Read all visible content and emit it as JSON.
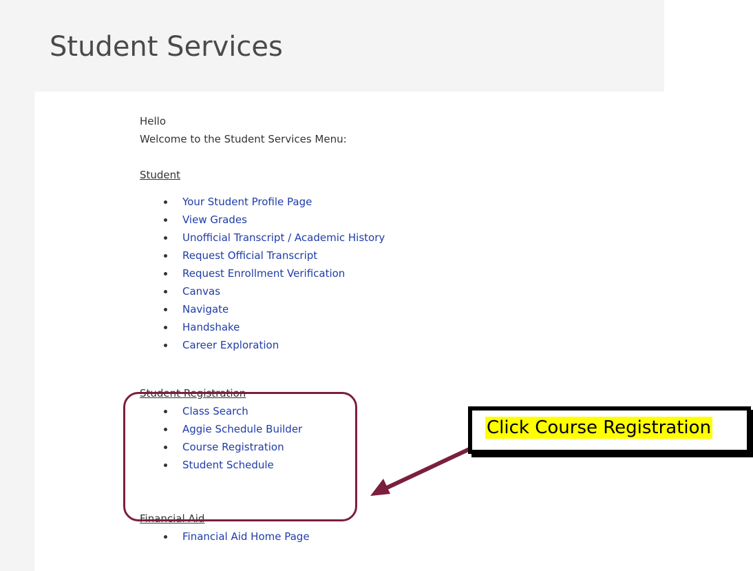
{
  "page": {
    "title": "Student Services"
  },
  "intro": {
    "greeting": "Hello",
    "welcome": "Welcome to the Student Services Menu:"
  },
  "sections": {
    "student": {
      "heading": "Student",
      "links": [
        "Your Student Profile Page",
        "View Grades",
        "Unofficial Transcript / Academic History",
        "Request Official Transcript",
        "Request Enrollment Verification",
        "Canvas",
        "Navigate",
        "Handshake",
        "Career Exploration"
      ]
    },
    "registration": {
      "heading": "Student Registration",
      "links": [
        "Class Search",
        "Aggie Schedule Builder",
        "Course Registration",
        "Student Schedule"
      ]
    },
    "financial_aid": {
      "heading": "Financial Aid",
      "links": [
        "Financial Aid Home Page"
      ]
    }
  },
  "annotation": {
    "callout_text": "Click Course Registration",
    "box_color": "#7a1f3d",
    "arrow_color": "#7a1f3d",
    "highlight_color": "#ffff00"
  },
  "colors": {
    "link": "#1f3ca8",
    "text": "#333333",
    "title": "#4a4a4a",
    "header_background": "#f4f4f4"
  }
}
